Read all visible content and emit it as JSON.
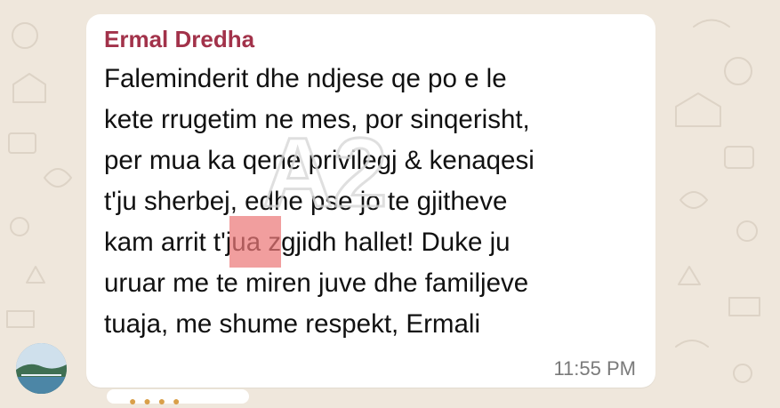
{
  "chat": {
    "sender_name": "Ermal Dredha",
    "message_lines": [
      "Faleminderit dhe ndjese qe po e le",
      "kete rrugetim ne mes, por sinqerisht,",
      "per mua ka qene privilegj & kenaqesi",
      "t'ju sherbej, edhe pse jo te gjitheve",
      "kam arrit t'jua zgjidh hallet! Duke ju",
      "uruar me te miren juve dhe familjeve",
      "tuaja, me shume respekt, Ermali"
    ],
    "timestamp": "11:55 PM"
  },
  "watermark": {
    "text": "A2",
    "color": "#d8d8d8"
  },
  "colors": {
    "background": "#efe7dc",
    "bubble": "#ffffff",
    "sender": "#a2324a",
    "text": "#111111",
    "timestamp": "#7a7a7a"
  },
  "icons": {
    "avatar": "profile-photo-landscape"
  }
}
